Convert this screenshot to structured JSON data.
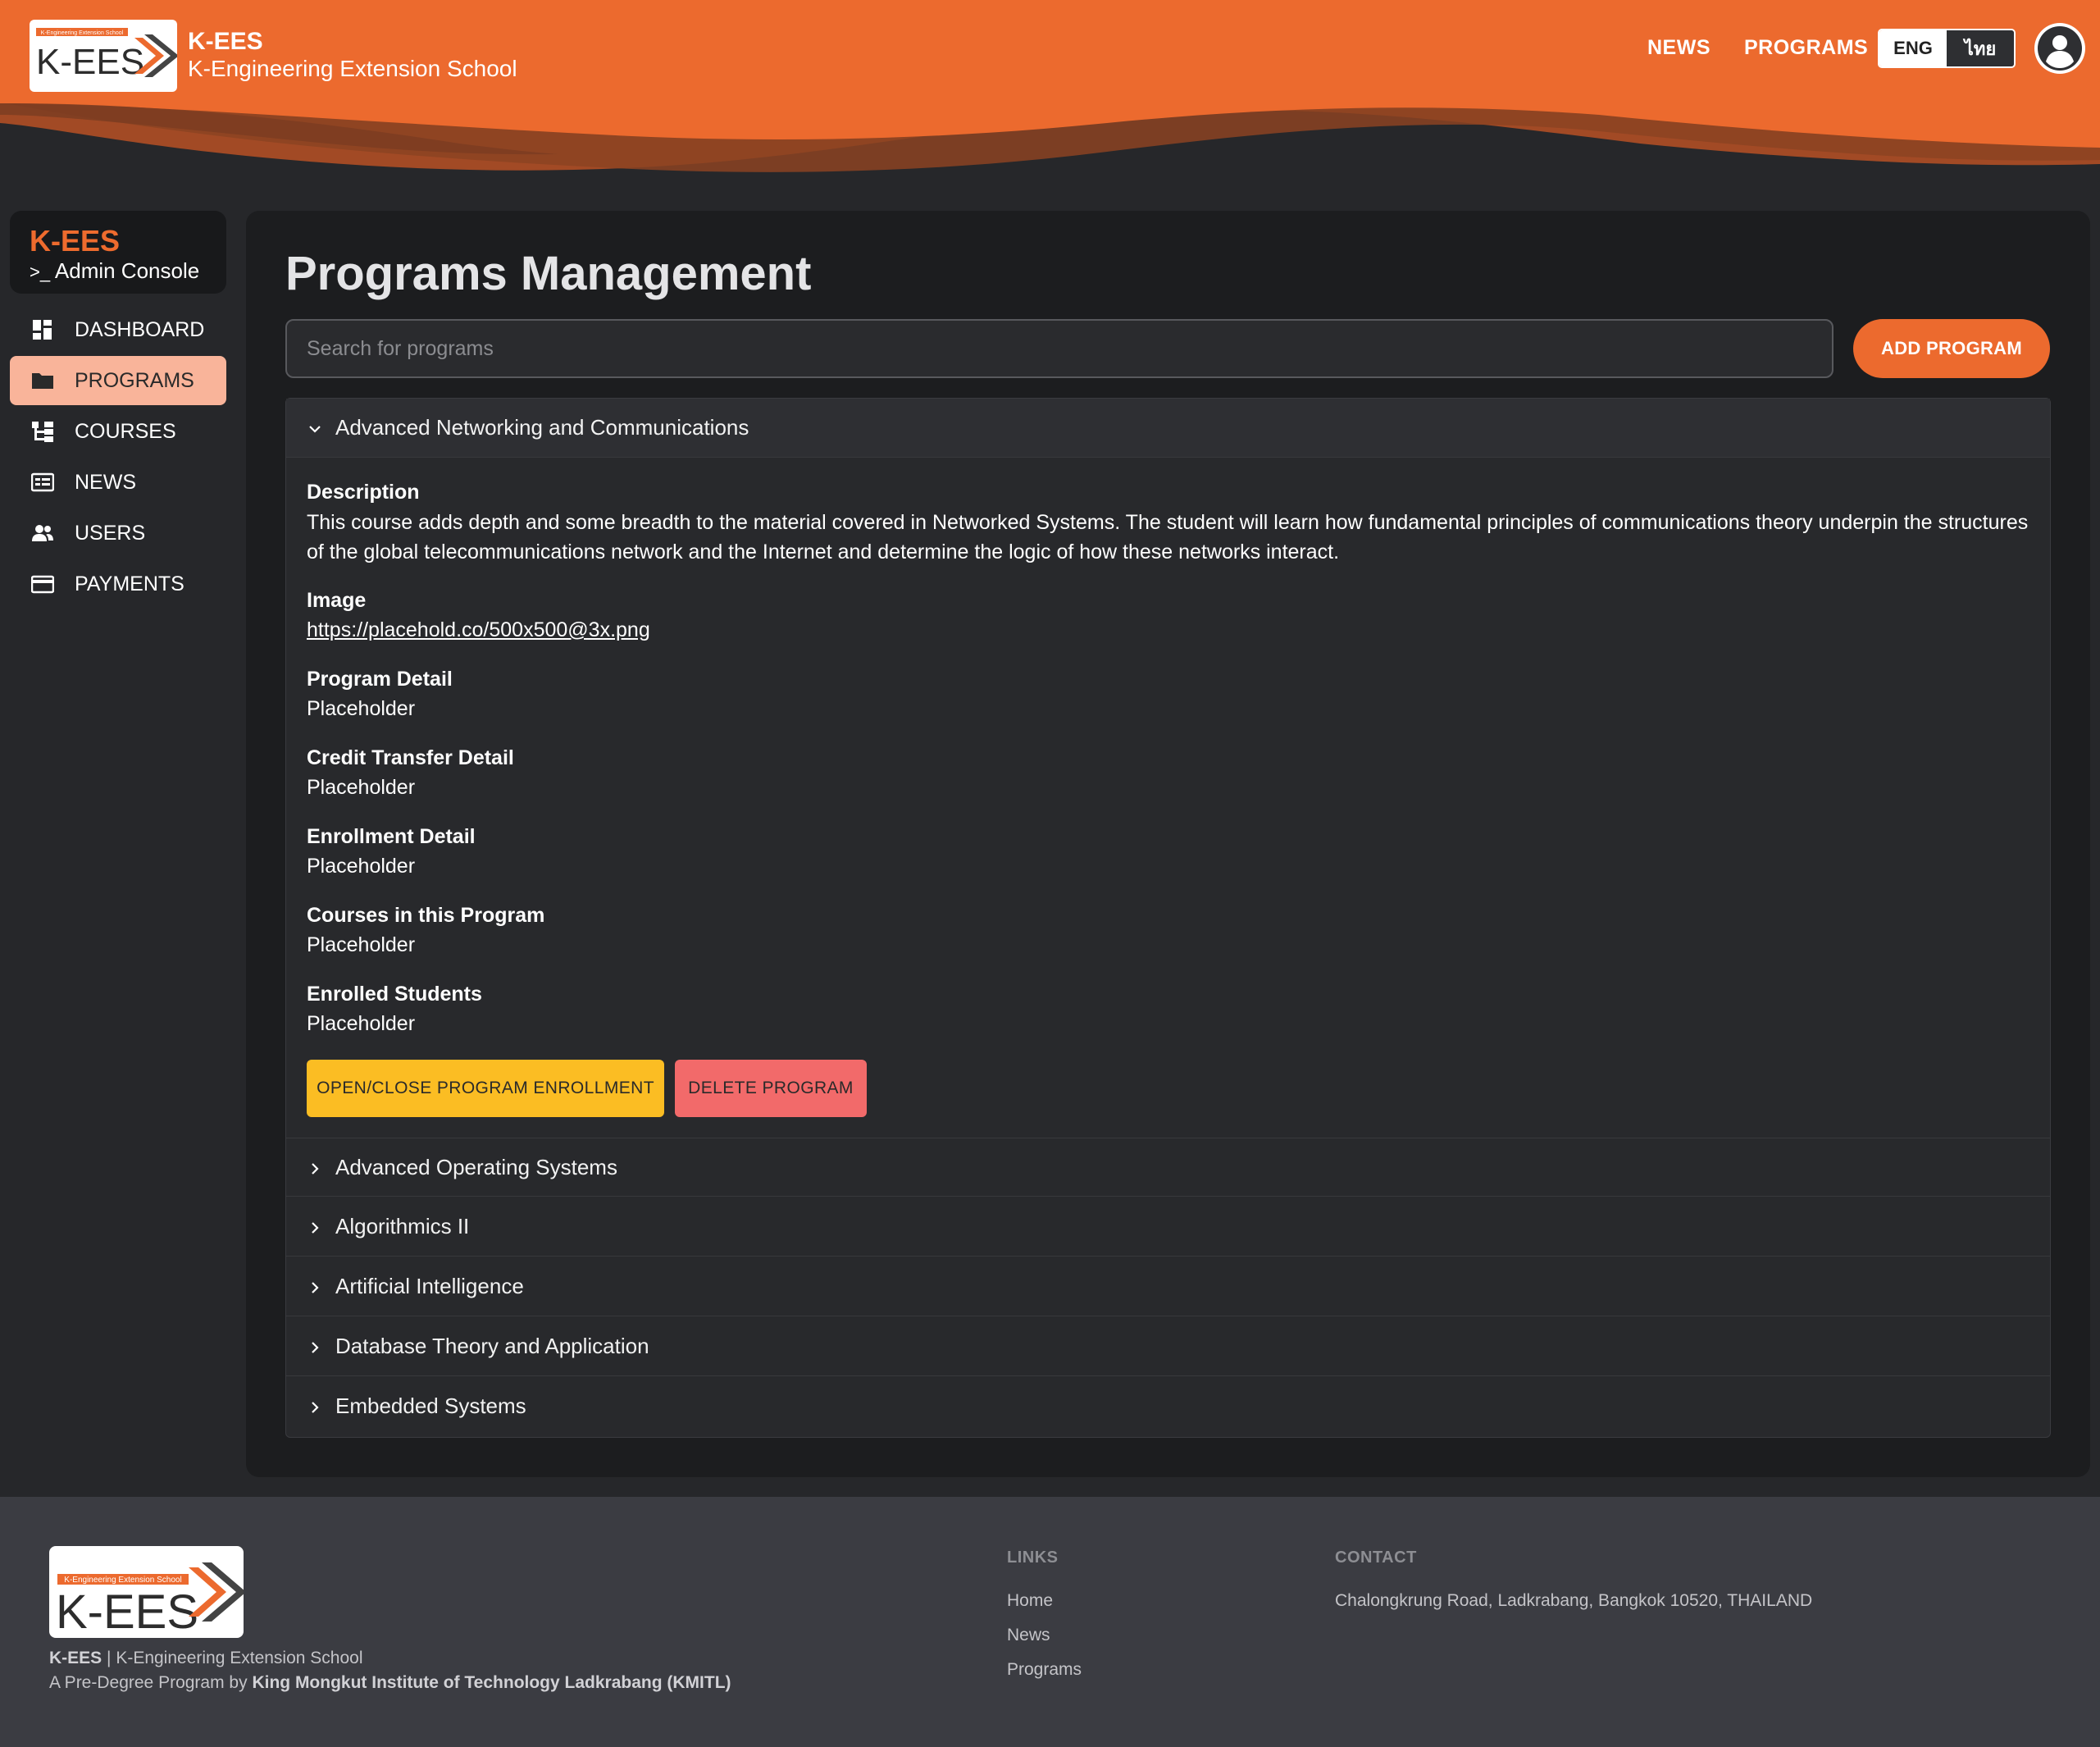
{
  "header": {
    "brand_title": "K-EES",
    "brand_subtitle": "K-Engineering Extension School",
    "logo_text": "K-EES",
    "logo_tagline": "K-Engineering Extension School",
    "nav": {
      "news": "NEWS",
      "programs": "PROGRAMS"
    },
    "lang": {
      "eng": "ENG",
      "thai": "ไทย",
      "active": "ENG"
    },
    "accent_color": "#ec6a2e"
  },
  "sidebar": {
    "brand": "K-EES",
    "console_label": "Admin Console",
    "items": [
      {
        "label": "DASHBOARD",
        "icon": "dashboard-icon"
      },
      {
        "label": "PROGRAMS",
        "icon": "folder-icon",
        "active": true
      },
      {
        "label": "COURSES",
        "icon": "hierarchy-icon"
      },
      {
        "label": "NEWS",
        "icon": "newspaper-icon"
      },
      {
        "label": "USERS",
        "icon": "users-icon"
      },
      {
        "label": "PAYMENTS",
        "icon": "credit-card-icon"
      }
    ]
  },
  "main": {
    "title": "Programs Management",
    "search_placeholder": "Search for programs",
    "add_button": "ADD PROGRAM",
    "expanded_program": {
      "name": "Advanced Networking and Communications",
      "description_label": "Description",
      "description": "This course adds depth and some breadth to the material covered in Networked Systems. The student will learn how fundamental principles of communications theory underpin the structures of the global telecommunications network and the Internet and determine the logic of how these networks interact.",
      "image_label": "Image",
      "image_url": "https://placehold.co/500x500@3x.png",
      "program_detail_label": "Program Detail",
      "program_detail": "Placeholder",
      "credit_transfer_label": "Credit Transfer Detail",
      "credit_transfer": "Placeholder",
      "enrollment_detail_label": "Enrollment Detail",
      "enrollment_detail": "Placeholder",
      "courses_label": "Courses in this Program",
      "courses": "Placeholder",
      "enrolled_label": "Enrolled Students",
      "enrolled": "Placeholder",
      "toggle_enrollment_button": "OPEN/CLOSE PROGRAM ENROLLMENT",
      "delete_button": "DELETE PROGRAM"
    },
    "collapsed_programs": [
      "Advanced Operating Systems",
      "Algorithmics II",
      "Artificial Intelligence",
      "Database Theory and Application",
      "Embedded Systems"
    ]
  },
  "footer": {
    "brand": "K-EES",
    "brand_full": "K-Engineering Extension School",
    "predegree_prefix": "A Pre-Degree Program by",
    "institute": "King Mongkut Institute of Technology Ladkrabang (KMITL)",
    "links_heading": "LINKS",
    "links": [
      "Home",
      "News",
      "Programs"
    ],
    "contact_heading": "CONTACT",
    "address": "Chalongkrung Road, Ladkrabang, Bangkok 10520, THAILAND"
  },
  "colors": {
    "orange": "#ec6a2e",
    "sidebar_active": "#f9b49a",
    "warning_yellow": "#fbbd23",
    "danger_red": "#f26a6a"
  }
}
